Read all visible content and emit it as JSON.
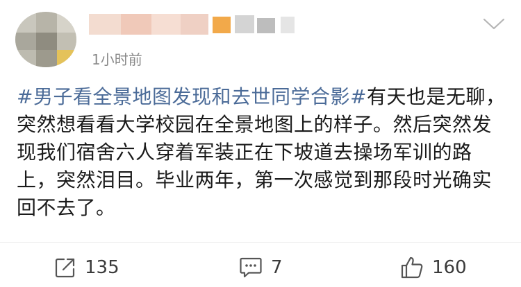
{
  "post": {
    "time": "1小时前",
    "hashtag": "#男子看全景地图发现和去世同学合影#",
    "text": "有天也是无聊，突然想看看大学校园在全景地图上的样子。然后突然发现我们宿舍六人穿着军装正在下坡道去操场军训的路上，突然泪目。毕业两年，第一次感觉到那段时光确实回不去了。"
  },
  "actions": {
    "repost_count": "135",
    "comment_count": "7",
    "like_count": "160"
  },
  "icons": {
    "menu": "chevron-down-icon",
    "repost": "share-icon",
    "comment": "comment-icon",
    "like": "thumbs-up-icon"
  },
  "colors": {
    "hashtag": "#4b6b98",
    "meta": "#8a8a8a",
    "action": "#3a3a3a"
  }
}
